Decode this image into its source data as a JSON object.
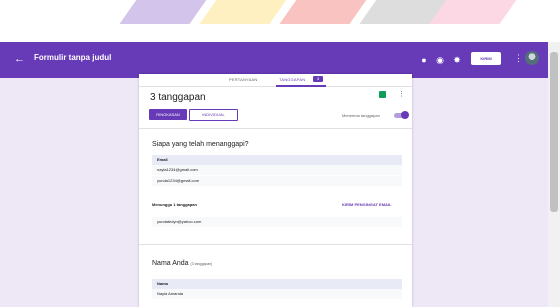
{
  "colors": {
    "brand": "#673ab7",
    "background": "#ede7f6",
    "sheets_green": "#0f9d58"
  },
  "header": {
    "back_icon": "arrow-back-icon",
    "title": "Formulir tanpa judul",
    "icons": [
      "palette-icon",
      "preview-eye-icon",
      "settings-gear-icon",
      "more-vert-icon"
    ],
    "send_label": "KIRIM"
  },
  "tabs": {
    "questions": "PERTANYAAN",
    "responses": "TANGGAPAN",
    "responses_count": "3"
  },
  "summary": {
    "count_text": "3 tanggapan",
    "view_summary": "RINGKASAN",
    "view_individual": "INDIVIDUAL",
    "accepting_label": "Menerima tanggapan",
    "accepting_on": true
  },
  "q1": {
    "title": "Siapa yang telah menanggapi?",
    "column": "Email",
    "rows": [
      "nayla1234@gmail.com",
      "yunda1234@gmail.com"
    ],
    "waiting_label": "Menunggu 1 tanggapan",
    "send_reminder": "KIRIM PENGINGAT EMAIL",
    "waiting_rows": [
      "yundatedyn@yahoo.com"
    ]
  },
  "q2": {
    "title": "Nama Anda",
    "count_note": "(3 tanggapan)",
    "column": "Nama",
    "rows": [
      "Nayla Amanda"
    ]
  }
}
